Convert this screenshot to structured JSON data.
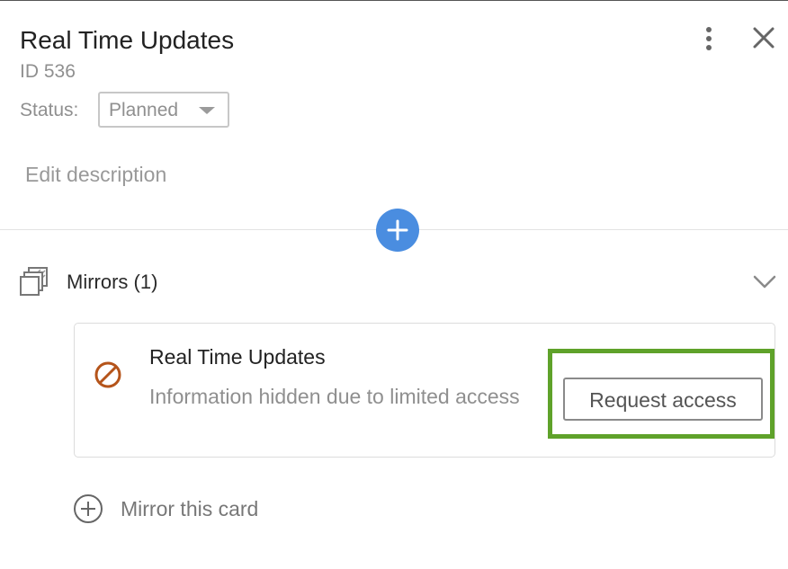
{
  "header": {
    "title": "Real Time Updates",
    "id_text": "ID 536",
    "status_label": "Status:",
    "status_value": "Planned",
    "more_icon": "kebab-vertical-icon",
    "close_icon": "close-icon"
  },
  "description": {
    "placeholder": "Edit description"
  },
  "add_button": {
    "icon": "plus-icon",
    "color": "#4a8de0"
  },
  "mirrors": {
    "icon": "mirrors-stack-icon",
    "label": "Mirrors (1)",
    "toggle_icon": "chevron-down-icon",
    "items": [
      {
        "icon": "blocked-icon",
        "icon_color": "#b5541a",
        "title": "Real Time Updates",
        "note": "Information hidden due to limited access",
        "action_label": "Request access"
      }
    ],
    "add_label": "Mirror this card",
    "add_icon": "plus-circle-icon"
  },
  "highlight_color": "#5fa22a"
}
